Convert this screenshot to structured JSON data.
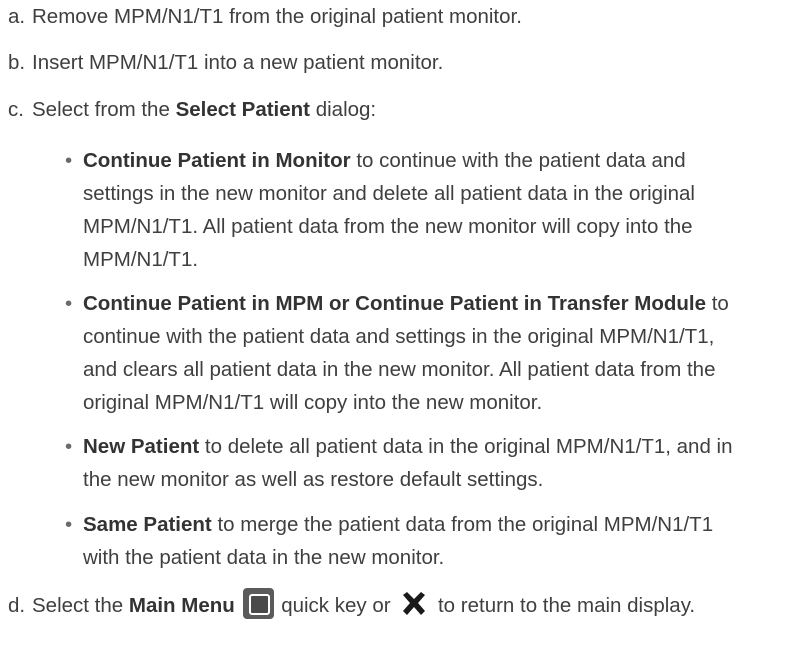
{
  "steps": [
    {
      "marker": "a.",
      "before": "Remove MPM/N1/T1 from the original patient monitor."
    },
    {
      "marker": "b.",
      "before": "Insert MPM/N1/T1 into a new patient monitor."
    },
    {
      "marker": "c.",
      "before": "Select from the ",
      "bold": "Select Patient",
      "after": " dialog:"
    },
    {
      "marker": "d.",
      "before": "Select the ",
      "bold": "Main Menu",
      "middle": " quick key or ",
      "after": " to return to the main display."
    }
  ],
  "options": [
    {
      "bullet": "•",
      "bold": "Continue Patient in Monitor",
      "lines": [
        " to continue with the patient data and",
        "settings in the new monitor and delete all patient data in the original",
        "MPM/N1/T1. All patient data from the new monitor will copy into the",
        "MPM/N1/T1."
      ]
    },
    {
      "bullet": "•",
      "bold": "Continue Patient in MPM or Continue Patient in Transfer Module",
      "lines": [
        " to",
        "continue with the patient data and settings in the original MPM/N1/T1,",
        "and clears all patient data in the new monitor. All patient data from the",
        "original MPM/N1/T1 will copy into the new monitor."
      ]
    },
    {
      "bullet": "•",
      "bold": "New Patient",
      "lines": [
        " to delete all patient data in the original MPM/N1/T1, and in",
        "the new monitor as well as restore default settings."
      ]
    },
    {
      "bullet": "•",
      "bold": "Same Patient",
      "lines": [
        " to merge the patient data from the original MPM/N1/T1",
        "with the patient data in the new monitor."
      ]
    }
  ],
  "icons": {
    "main_menu": "main-menu-icon",
    "close": "close-x-icon"
  }
}
